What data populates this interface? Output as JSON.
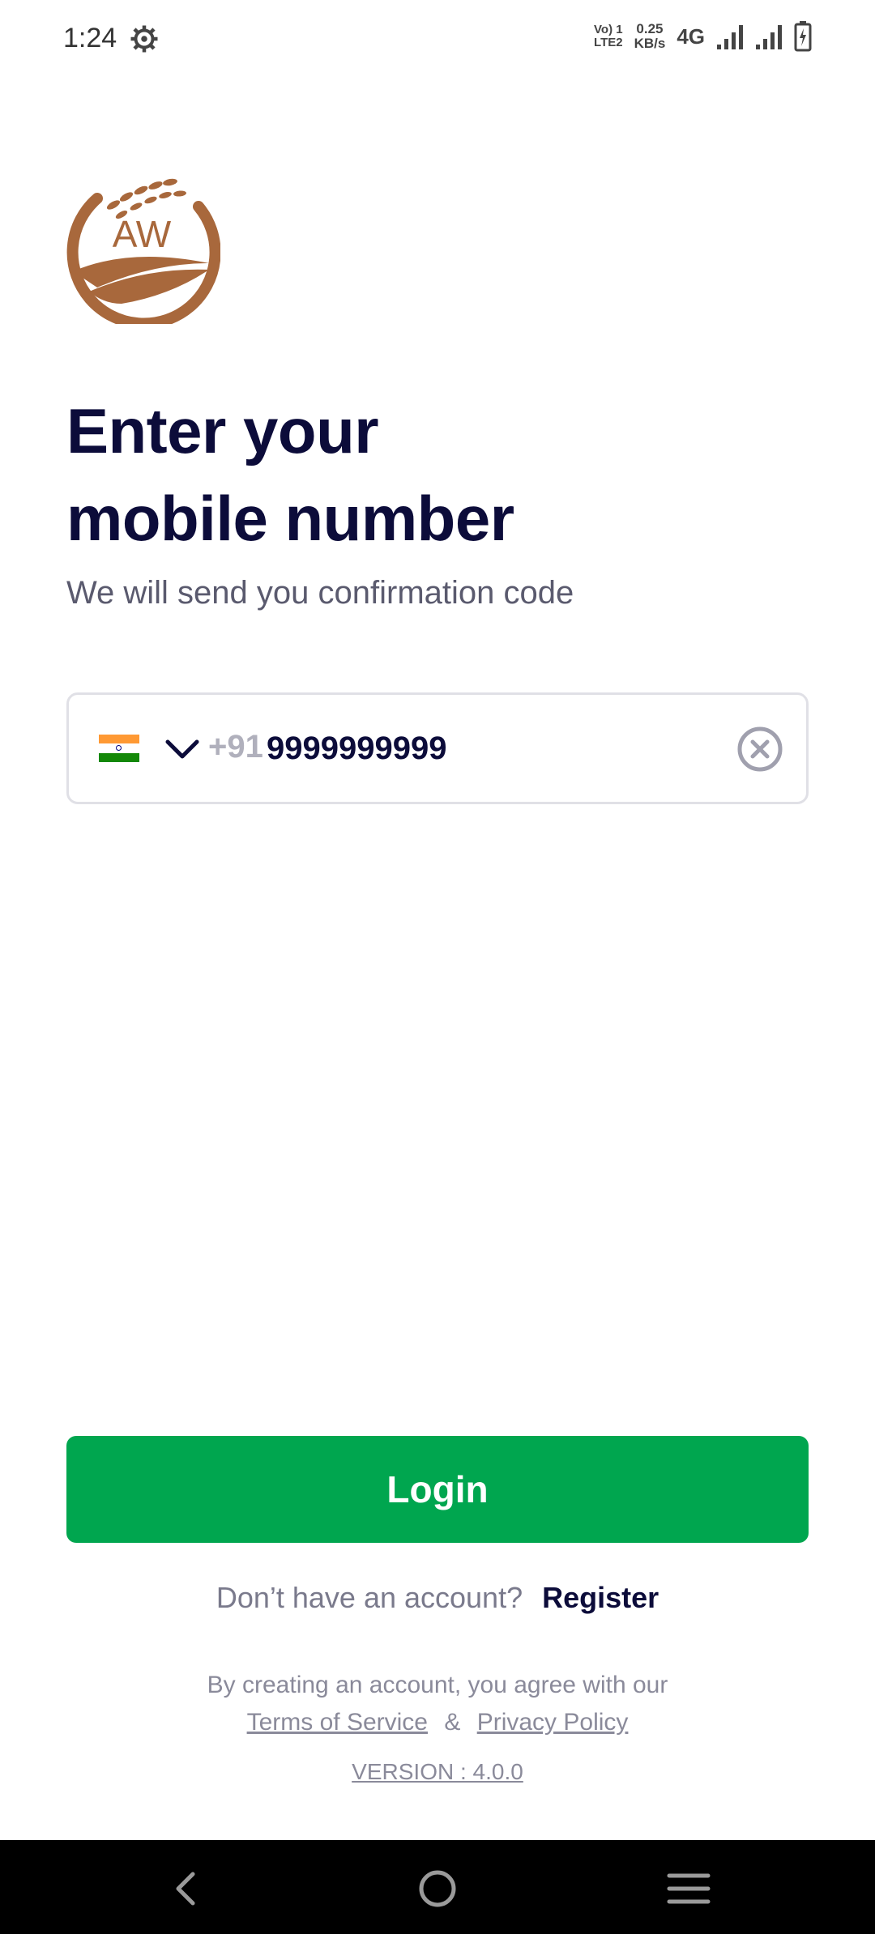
{
  "status_bar": {
    "time": "1:24",
    "lte_top": "Vo) 1",
    "lte_bottom": "LTE2",
    "speed_top": "0.25",
    "speed_bottom": "KB/s",
    "network": "4G"
  },
  "logo": {
    "text": "AW",
    "color": "#a8683c"
  },
  "heading": {
    "line1": "Enter your",
    "line2": "mobile number"
  },
  "subtitle": "We will send you confirmation code",
  "phone": {
    "country_code": "+91",
    "value": "9999999999",
    "flag_colors": [
      "#ff9933",
      "#ffffff",
      "#138808"
    ]
  },
  "login_label": "Login",
  "register": {
    "question": "Don’t have an account?",
    "link": "Register"
  },
  "legal": {
    "agree_text": "By creating an account, you agree with our",
    "terms": "Terms of Service",
    "amp": "&",
    "privacy": "Privacy Policy"
  },
  "version": "VERSION : 4.0.0",
  "colors": {
    "primary": "#00a64f",
    "heading": "#0c0c3a"
  },
  "icons": [
    "gear-icon",
    "signal-icon",
    "battery-icon",
    "chevron-down-icon",
    "clear-icon",
    "back-icon",
    "home-icon",
    "menu-icon"
  ]
}
